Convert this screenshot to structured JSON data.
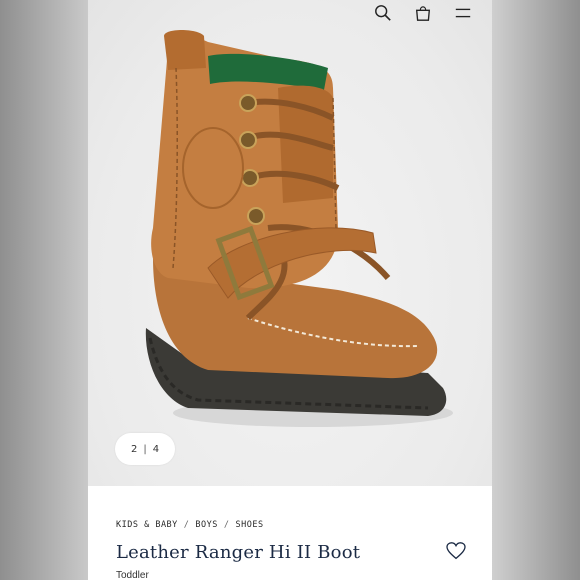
{
  "header": {
    "icons": [
      "search-icon",
      "shopping-bag-icon",
      "menu-icon"
    ]
  },
  "gallery": {
    "current_page": "2",
    "separator": "|",
    "total_pages": "4"
  },
  "product": {
    "breadcrumb": [
      "KIDS & BABY",
      "BOYS",
      "SHOES"
    ],
    "breadcrumb_separator": "/",
    "title": "Leather Ranger Hi II Boot",
    "subtitle": "Toddler"
  },
  "colors": {
    "boot_leather": "#b8743a",
    "sole": "#3b3a36",
    "lining": "#1f6b3a",
    "title_text": "#1b2a44"
  }
}
